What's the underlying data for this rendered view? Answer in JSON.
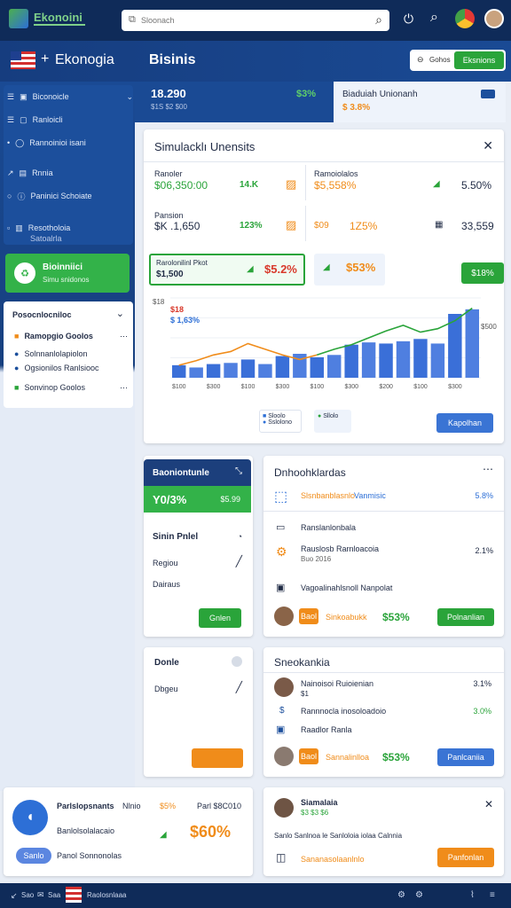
{
  "brand": {
    "name": "Ekonoini",
    "logo_text": "Ekonogia"
  },
  "search": {
    "placeholder": "Sloonach"
  },
  "subheader": {
    "title": "Bisinis",
    "stat1_value": "18.290",
    "stat1_sub": "$1S $2 $00",
    "stat1_change": "$3%",
    "panel_title": "Biaduiah Unionanh",
    "panel_value": "$ 3.8%",
    "filter_label": "Gohos",
    "filter_button": "Eksnions"
  },
  "sidebar": {
    "items": [
      {
        "label": "Biconoicle",
        "icon": "grid-icon"
      },
      {
        "label": "Ranloicli",
        "icon": "page-icon"
      },
      {
        "label": "Rannoinioi isani",
        "icon": "chat-icon"
      },
      {
        "label": "Rnnia",
        "icon": "tag-icon"
      },
      {
        "label": "Paninici Schoiate",
        "icon": "info-icon"
      },
      {
        "label": "Resotholoia",
        "sub": "Satoalrla",
        "icon": "box-icon"
      }
    ],
    "active": {
      "title": "Bioinniici",
      "sub": "Simu snidonos"
    },
    "section_title": "Posocnlocniloc",
    "sub_items": [
      {
        "label": "Ramopgio Goolos"
      },
      {
        "label": "Solnnanlolapiolon"
      },
      {
        "label": "Ogsionilos Ranlsiooc"
      },
      {
        "label": "Sonvinop Goolos"
      }
    ]
  },
  "simulation": {
    "title": "Simulacklı Unensits",
    "rows": [
      {
        "label": "Ranoler",
        "value": "$06,350:00",
        "pct": "14.K",
        "r_label": "Ramoiolalos",
        "r_value": "$5,558%",
        "r_pct": "5.50%"
      },
      {
        "label": "Pansion",
        "value": "$K .1,650",
        "pct": "123%",
        "r_value": "$09",
        "r_pct": "1Z5%",
        "r_right": "33,559"
      }
    ],
    "highlight_label": "Rarolonilinl Pkot",
    "highlight_value": "$1,500",
    "highlight_pct": "$5.2%",
    "second_pct": "$53%",
    "chart": {
      "y_label1": "$18",
      "y_label2": "$ 1,63%",
      "tag": "$18%",
      "right_axis": "$500",
      "button": "Kapolhan",
      "legend1": "Sloolo",
      "legend2": "Sslolono",
      "legend3": "Sllolo"
    }
  },
  "chart_data": {
    "type": "bar",
    "categories": [
      "$100",
      "",
      "$300",
      "",
      "$100",
      "",
      "$300",
      "",
      "$100",
      "",
      "$300",
      "",
      "$200",
      "",
      "$100",
      "",
      "$300",
      ""
    ],
    "series": [
      {
        "name": "",
        "values": [
          22,
          18,
          24,
          26,
          32,
          24,
          38,
          42,
          36,
          40,
          58,
          62,
          60,
          64,
          68,
          60,
          112,
          120
        ]
      },
      {
        "name": "",
        "values": [
          22,
          30,
          40,
          46,
          60,
          50,
          40,
          32,
          40,
          50,
          58,
          70,
          82,
          92,
          80,
          86,
          100,
          122
        ]
      }
    ],
    "ylim": [
      0,
      140
    ]
  },
  "card_small1": {
    "header": "Baoniontunle",
    "value": "Y0/3%",
    "right": "$5.99",
    "title": "Sinin Pnlel",
    "line1": "Regiou",
    "line2": "Dairaus",
    "button": "Gnlen"
  },
  "card_big1": {
    "title": "Dnhoohklardas",
    "row1": "Slsnbanblasnlo",
    "row1_blue": "Vanmisic",
    "row1_right": "5.8%",
    "row2": "Ranslanlonbala",
    "row3": "Rauslosb Rarnloacoia",
    "row3_sub": "Buo 2016",
    "row3_right": "2.1%",
    "row4": "Vagoalinahlsnoll Nanpolat",
    "button_orange": "Baol",
    "row5_text": "Sinkoabukk",
    "row5_value": "$53%",
    "row5_button": "Polnanlian"
  },
  "card_small2": {
    "title": "Donle",
    "line1": "Dbgeu"
  },
  "card_big2": {
    "title": "Sneokankia",
    "row1": "Nainoisoi Ruioienian",
    "row1_sub": "$1",
    "row1_right": "3.1%",
    "row2": "Rannnocla inosoloadoio",
    "row2_right": "3.0%",
    "row3": "Raadlor Ranla",
    "button_orange": "Baol",
    "row4_text": "Sannalinlloa",
    "row4_value": "$53%",
    "row4_button": "Panlcaniia"
  },
  "bottom_left": {
    "title": "Parlslopsnants",
    "mid": "Nlnio",
    "pct": "$5%",
    "right": "Parl $8C010",
    "line": "Banlolsolalacaio",
    "value": "$60%",
    "pill": "Sanlo",
    "line2": "Panol Sonnonolas"
  },
  "bottom_right": {
    "title": "Siamalaia",
    "sub": "$3 $3 $6",
    "text": "Sanlo Sanlnoa le Sanloloia iolaa Calnnia",
    "link": "Sananasolaanlnlo",
    "button": "Panfonlan"
  },
  "footer": {
    "left": "Sao",
    "mid": "Saa",
    "tab": "Raolosnlaaa"
  },
  "colors": {
    "navy": "#0f2b59",
    "blue": "#2d6fd6",
    "green": "#2aa43a",
    "orange": "#f08c1a"
  }
}
